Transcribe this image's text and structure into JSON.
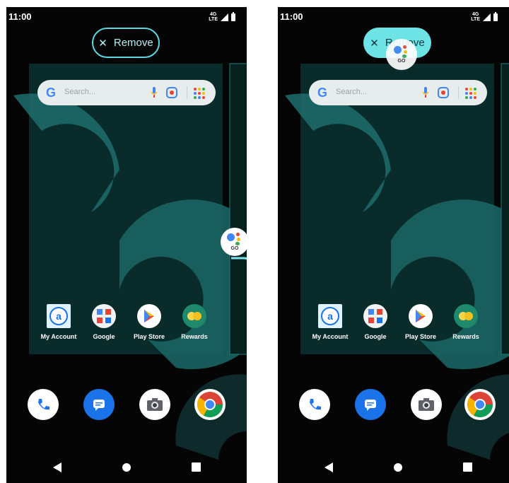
{
  "status": {
    "time": "11:00",
    "network": "4G LTE"
  },
  "remove_label": "Remove",
  "remove_icon": "close-icon",
  "search": {
    "placeholder": "Search..."
  },
  "apps": [
    {
      "label": "My Account",
      "icon": "my-account-icon"
    },
    {
      "label": "Google",
      "icon": "google-folder-icon"
    },
    {
      "label": "Play Store",
      "icon": "play-store-icon"
    },
    {
      "label": "Rewards",
      "icon": "rewards-icon"
    }
  ],
  "dock": [
    {
      "icon": "phone-icon"
    },
    {
      "icon": "messages-icon"
    },
    {
      "icon": "camera-icon"
    },
    {
      "icon": "chrome-icon"
    }
  ],
  "go_badge": "GO",
  "colors": {
    "accent": "#5fd6df",
    "wallpaper": "#092b2a",
    "arc": "#1b6b6a"
  }
}
